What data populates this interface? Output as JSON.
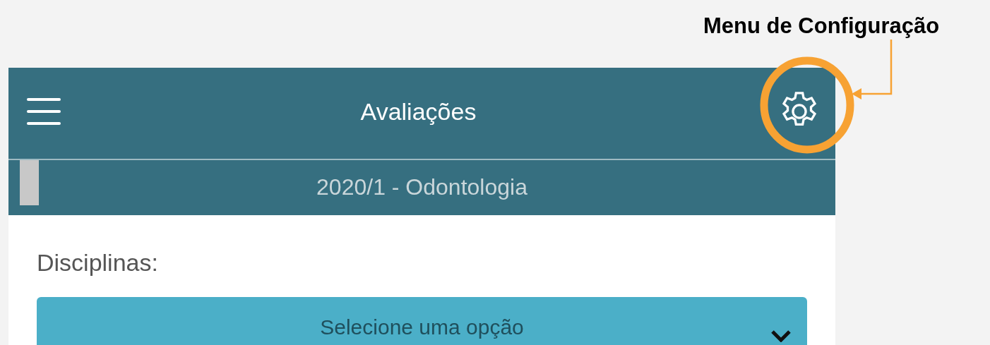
{
  "annotation": {
    "label": "Menu de Configuração"
  },
  "app_bar": {
    "title": "Avaliações"
  },
  "period_bar": {
    "label": "2020/1 - Odontologia"
  },
  "content": {
    "label": "Disciplinas:",
    "select": {
      "placeholder": "Selecione uma opção"
    }
  }
}
